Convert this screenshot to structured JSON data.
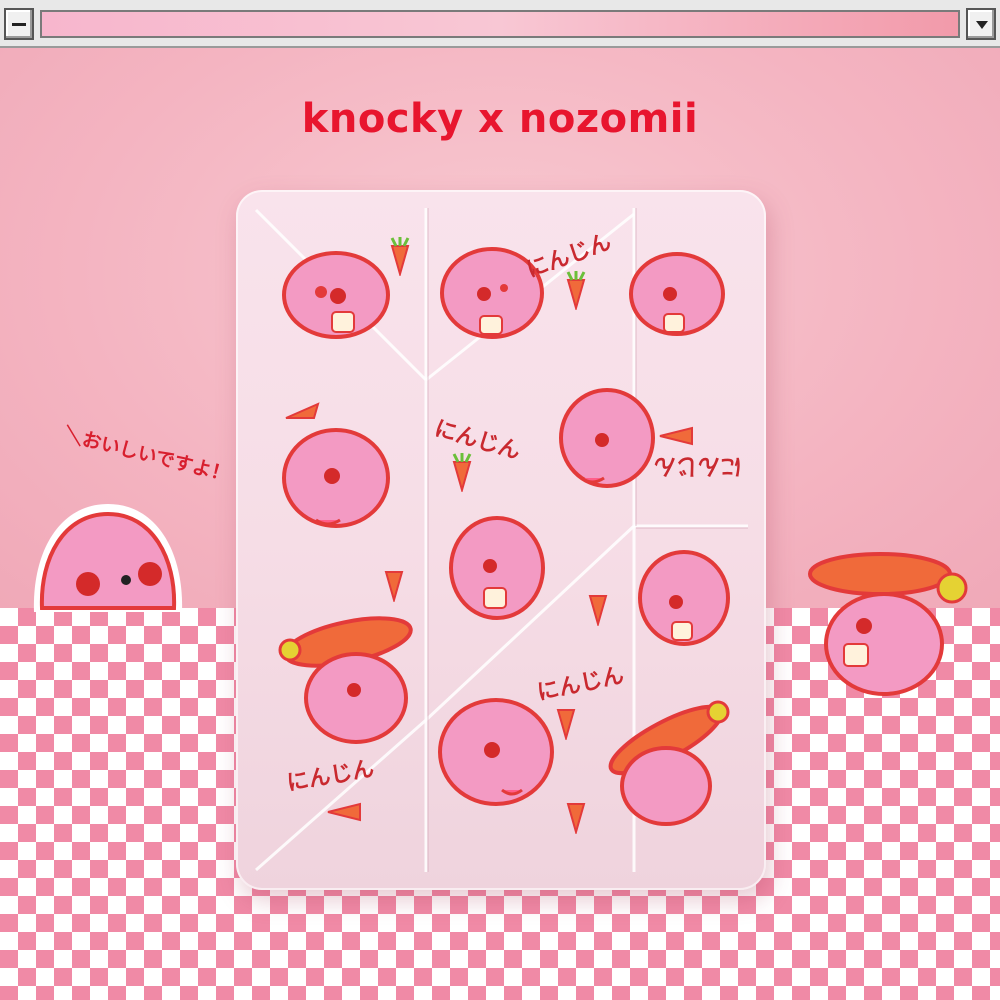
{
  "window": {
    "minimize_icon": "minimize-icon",
    "dropdown_icon": "chevron-down-icon"
  },
  "brand": {
    "title": "knocky x nozomii",
    "color": "#e8152e"
  },
  "case": {
    "labels": [
      "にんじん",
      "にんじん",
      "にんじん",
      "にんじん",
      "にんじん"
    ]
  },
  "sticker": {
    "speech": "＼おいしいですよ！"
  },
  "colors": {
    "wall": "#f5b8c4",
    "check_pink": "#f08aa6",
    "bunny_pink": "#f39ac3",
    "outline_red": "#e33a3a",
    "carrot_orange": "#f06a3a"
  }
}
